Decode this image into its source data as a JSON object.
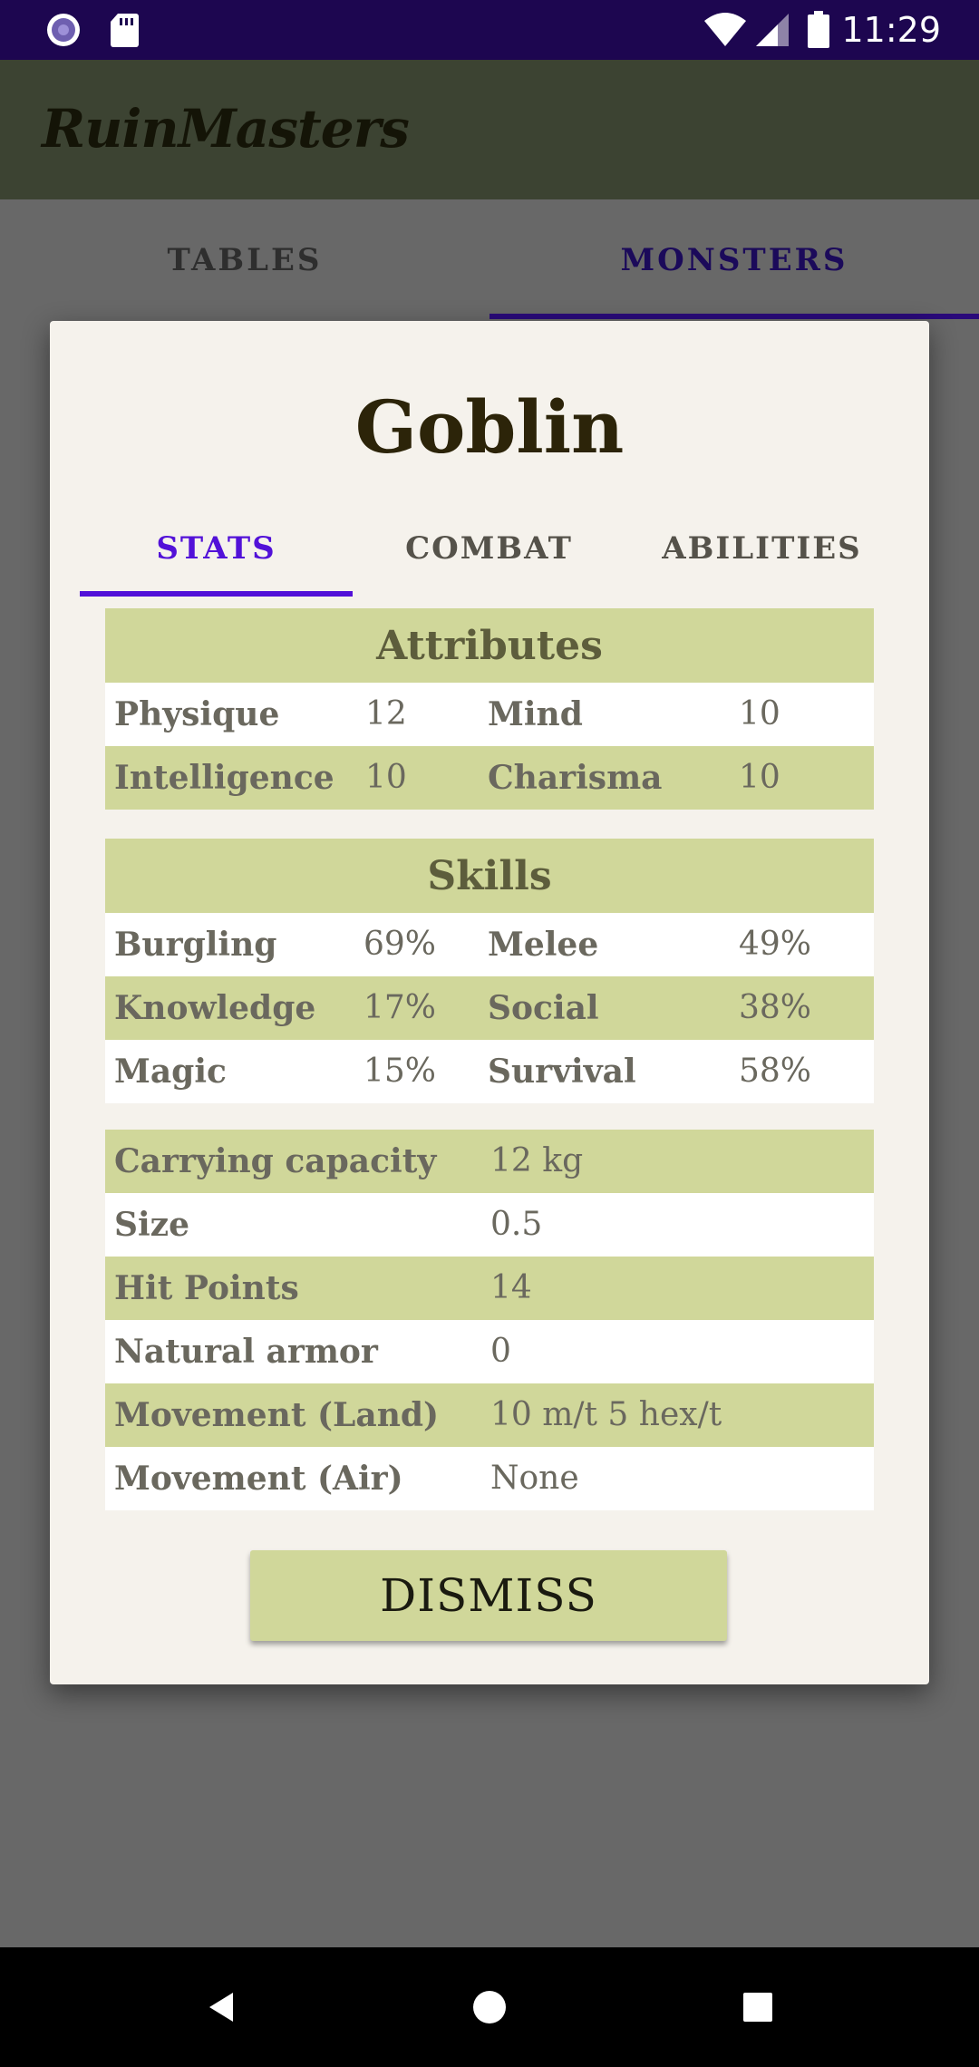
{
  "status_bar": {
    "time": "11:29",
    "icons": [
      "app-circle-icon",
      "sd-card-icon",
      "wifi-icon",
      "signal-icon",
      "battery-icon"
    ]
  },
  "app_bar": {
    "title": "RuinMasters"
  },
  "main_tabs": [
    {
      "label": "TABLES",
      "active": false
    },
    {
      "label": "MONSTERS",
      "active": true
    }
  ],
  "dialog": {
    "title": "Goblin",
    "tabs": [
      {
        "label": "STATS",
        "active": true
      },
      {
        "label": "COMBAT",
        "active": false
      },
      {
        "label": "ABILITIES",
        "active": false
      }
    ],
    "attributes": {
      "header": "Attributes",
      "rows": [
        {
          "name1": "Physique",
          "value1": "12",
          "name2": "Mind",
          "value2": "10"
        },
        {
          "name1": "Intelligence",
          "value1": "10",
          "name2": "Charisma",
          "value2": "10"
        }
      ]
    },
    "skills": {
      "header": "Skills",
      "rows": [
        {
          "name1": "Burgling",
          "value1": "69%",
          "name2": "Melee",
          "value2": "49%"
        },
        {
          "name1": "Knowledge",
          "value1": "17%",
          "name2": "Social",
          "value2": "38%"
        },
        {
          "name1": "Magic",
          "value1": "15%",
          "name2": "Survival",
          "value2": "58%"
        }
      ]
    },
    "properties": [
      {
        "name": "Carrying capacity",
        "value": "12 kg"
      },
      {
        "name": "Size",
        "value": "0.5"
      },
      {
        "name": "Hit Points",
        "value": "14"
      },
      {
        "name": "Natural armor",
        "value": "0"
      },
      {
        "name": "Movement (Land)",
        "value": "10 m/t 5 hex/t"
      },
      {
        "name": "Movement (Air)",
        "value": "None"
      }
    ],
    "dismiss_label": "DISMISS"
  },
  "nav_bar": {
    "icons": [
      "back-icon",
      "home-icon",
      "recents-icon"
    ]
  },
  "colors": {
    "status_bar": "#1d0650",
    "accent": "#5211d8",
    "table_highlight": "#d0d79a",
    "dialog_bg": "#f5f2ec",
    "scrim": "#686868"
  }
}
